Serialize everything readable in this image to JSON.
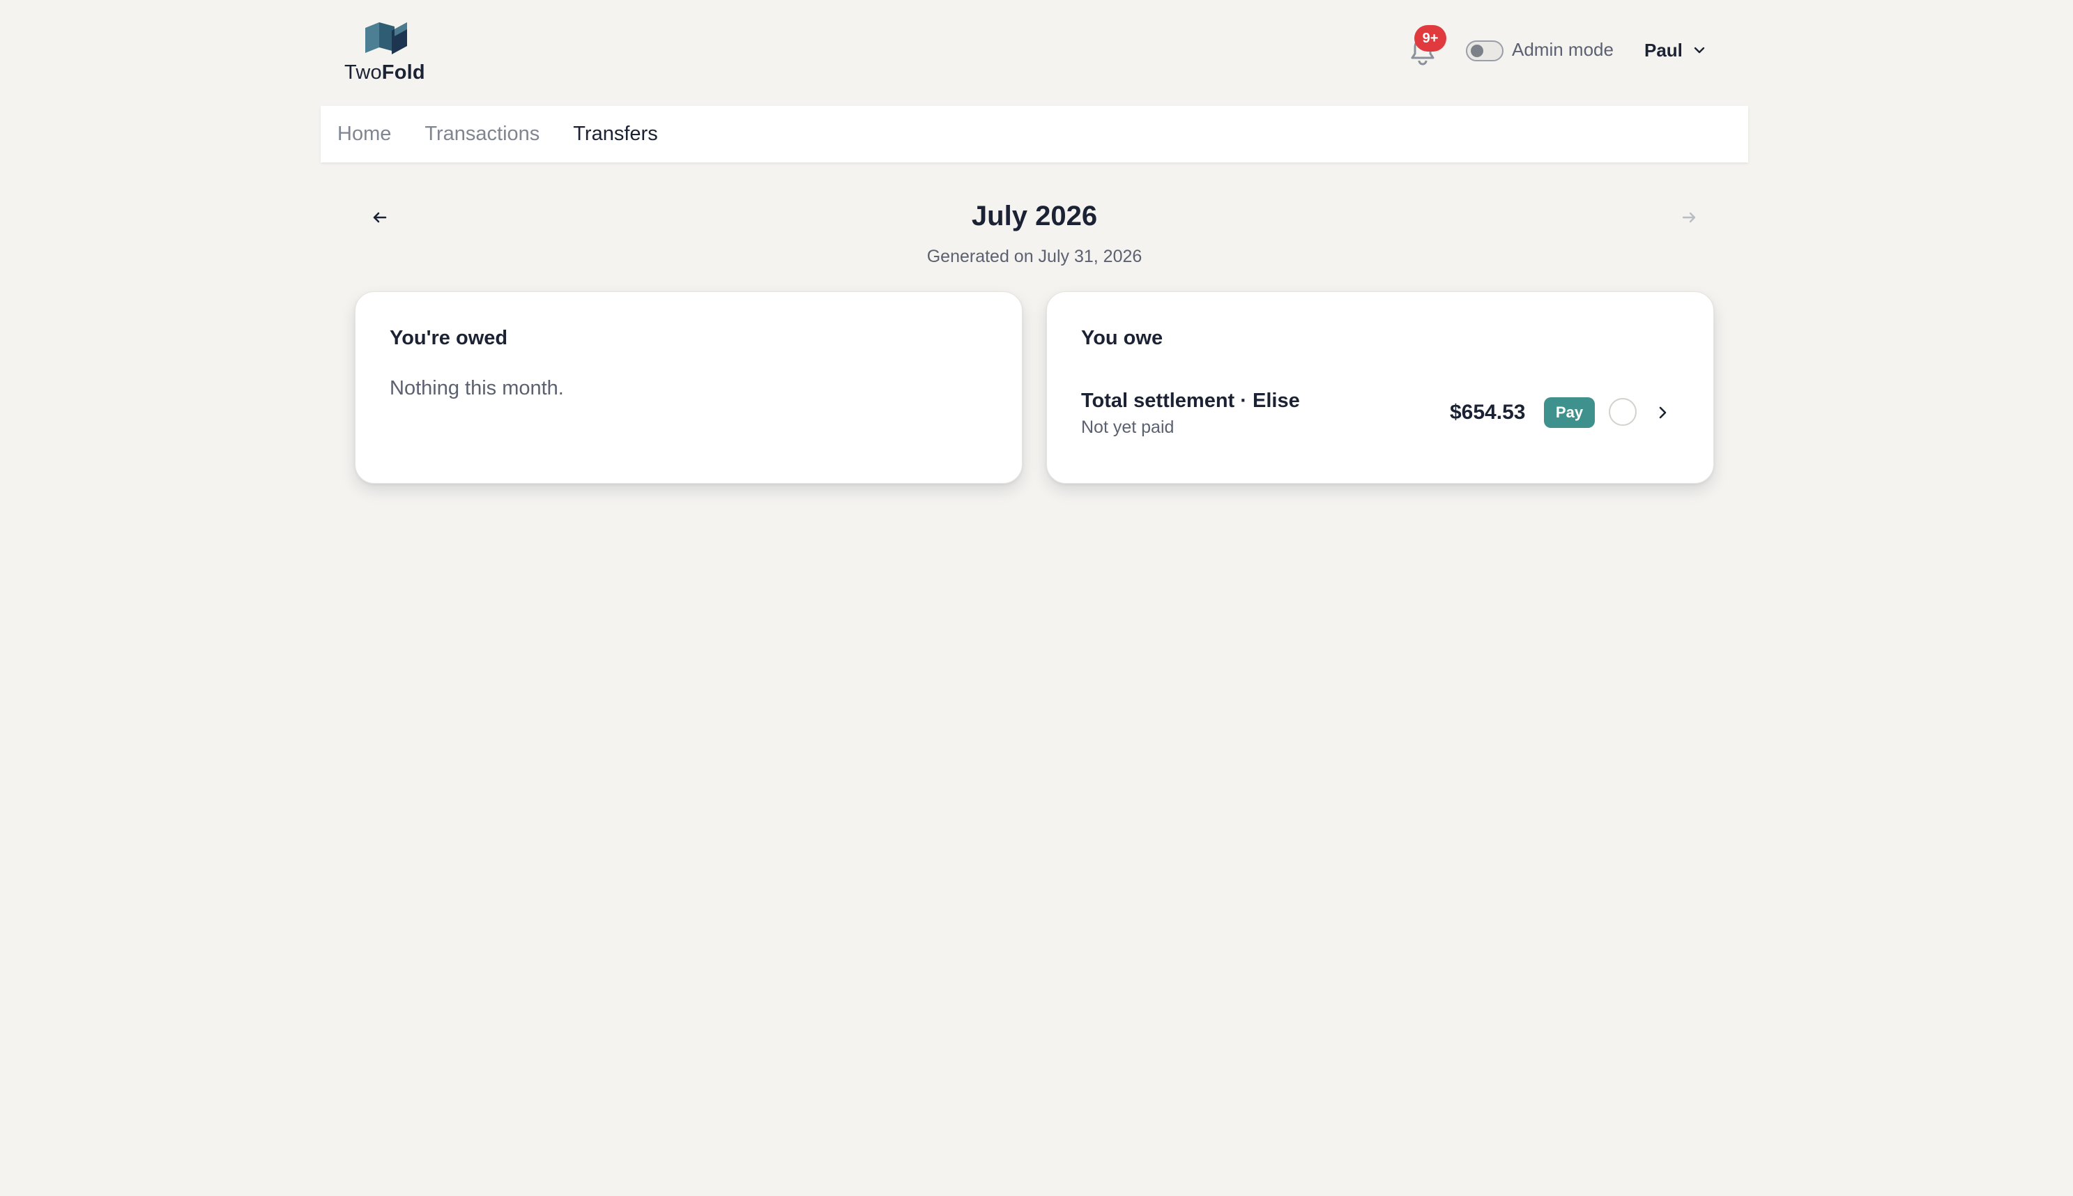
{
  "brand": {
    "name_light": "Two",
    "name_bold": "Fold"
  },
  "header": {
    "notifications_badge": "9+",
    "admin_mode_label": "Admin mode",
    "admin_mode_on": false,
    "user_name": "Paul"
  },
  "nav": {
    "items": [
      {
        "label": "Home",
        "active": false
      },
      {
        "label": "Transactions",
        "active": false
      },
      {
        "label": "Transfers",
        "active": true
      }
    ]
  },
  "period": {
    "title": "July 2026",
    "generated": "Generated on July 31, 2026"
  },
  "owed_card": {
    "title": "You're owed",
    "empty_message": "Nothing this month."
  },
  "owe_card": {
    "title": "You owe",
    "items": [
      {
        "title": "Total settlement · Elise",
        "status": "Not yet paid",
        "amount": "$654.53",
        "action_label": "Pay"
      }
    ]
  },
  "colors": {
    "background": "#f4f3f0",
    "accent_pay": "#3f918d",
    "badge": "#e03a3e",
    "text_primary": "#1b2233",
    "text_muted": "#5b6170"
  }
}
